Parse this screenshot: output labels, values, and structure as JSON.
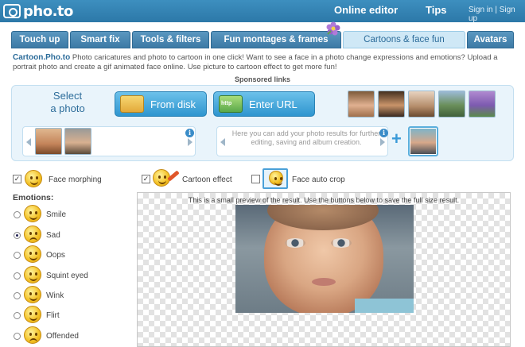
{
  "header": {
    "logo": "pho.to",
    "nav_online_editor": "Online editor",
    "nav_tips": "Tips",
    "sign_links": "Sign in | Sign up"
  },
  "tabs": [
    {
      "label": "Touch up"
    },
    {
      "label": "Smart fix"
    },
    {
      "label": "Tools & filters"
    },
    {
      "label": "Fun montages & frames"
    },
    {
      "label": "Cartoons & face fun",
      "active": true
    },
    {
      "label": "Avatars"
    }
  ],
  "intro": {
    "brand": "Cartoon.Pho.to",
    "text": " Photo caricatures and photo to cartoon in one click! Want to see a face in a photo change expressions and emotions? Upload a portrait photo and create a gif animated face online. Use picture to cartoon effect to get more fun!"
  },
  "sponsored": "Sponsored links",
  "upload": {
    "select_line1": "Select",
    "select_line2": "a photo",
    "from_disk": "From disk",
    "enter_url": "Enter URL",
    "results_hint": "Here you can add your photo results for further editing, saving and album creation."
  },
  "options": {
    "face_morphing": "Face morphing",
    "cartoon_effect": "Cartoon effect",
    "face_auto_crop": "Face auto crop",
    "face_morphing_checked": true,
    "cartoon_effect_checked": true,
    "face_auto_crop_checked": false
  },
  "emotions": {
    "title": "Emotions:",
    "items": [
      {
        "label": "Smile",
        "selected": false
      },
      {
        "label": "Sad",
        "selected": true
      },
      {
        "label": "Oops",
        "selected": false
      },
      {
        "label": "Squint eyed",
        "selected": false
      },
      {
        "label": "Wink",
        "selected": false
      },
      {
        "label": "Flirt",
        "selected": false
      },
      {
        "label": "Offended",
        "selected": false
      }
    ]
  },
  "preview": {
    "note": "This is a small preview of the result. Use the buttons below to save the full size result."
  },
  "icons": {
    "info": "i",
    "plus": "+",
    "check": "✓"
  }
}
